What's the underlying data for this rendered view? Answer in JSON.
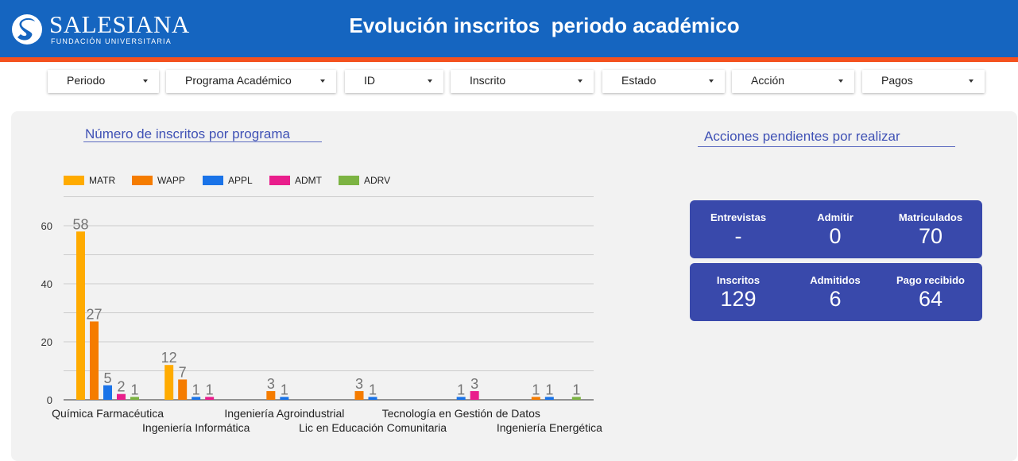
{
  "header": {
    "logo_text": "SALESIANA",
    "logo_subtext": "FUNDACIÓN UNIVERSITARIA",
    "title": "Evolución inscritos  periodo académico",
    "colors": {
      "bar": "#1565c0",
      "stripe": "#f4511e"
    }
  },
  "filters": [
    {
      "label": "Periodo"
    },
    {
      "label": "Programa Académico"
    },
    {
      "label": "ID"
    },
    {
      "label": "Inscrito"
    },
    {
      "label": "Estado"
    },
    {
      "label": "Acción"
    },
    {
      "label": "Pagos"
    }
  ],
  "chart_section": {
    "title": "Número de inscritos por programa"
  },
  "kpi_section": {
    "title": "Acciones pendientes por realizar"
  },
  "kpis": {
    "row1": [
      {
        "label": "Entrevistas",
        "value": "-"
      },
      {
        "label": "Admitir",
        "value": "0"
      },
      {
        "label": "Matriculados",
        "value": "70"
      }
    ],
    "row2": [
      {
        "label": "Inscritos",
        "value": "129"
      },
      {
        "label": "Admitidos",
        "value": "6"
      },
      {
        "label": "Pago recibido",
        "value": "64"
      }
    ],
    "color": "#3949ab"
  },
  "chart_data": {
    "type": "bar",
    "title": "Número de inscritos por programa",
    "categories": [
      "Química Farmacéutica",
      "Ingeniería Informática",
      "Ingeniería Agroindustrial",
      "Lic en Educación Comunitaria",
      "Tecnología en Gestión de Datos",
      "Ingeniería Energética"
    ],
    "series": [
      {
        "name": "MATR",
        "color": "#ffab00",
        "values": [
          58,
          12,
          null,
          null,
          null,
          null
        ]
      },
      {
        "name": "WAPP",
        "color": "#f57c00",
        "values": [
          27,
          7,
          3,
          3,
          null,
          1
        ]
      },
      {
        "name": "APPL",
        "color": "#1a73e8",
        "values": [
          5,
          1,
          1,
          1,
          1,
          1
        ]
      },
      {
        "name": "ADMT",
        "color": "#e91e8c",
        "values": [
          2,
          1,
          null,
          null,
          3,
          null
        ]
      },
      {
        "name": "ADRV",
        "color": "#7cb342",
        "values": [
          1,
          null,
          null,
          null,
          null,
          1
        ]
      }
    ],
    "yticks": [
      0,
      20,
      40,
      60
    ],
    "ylim": [
      0,
      70
    ],
    "legend": "top-left",
    "grid": true
  }
}
